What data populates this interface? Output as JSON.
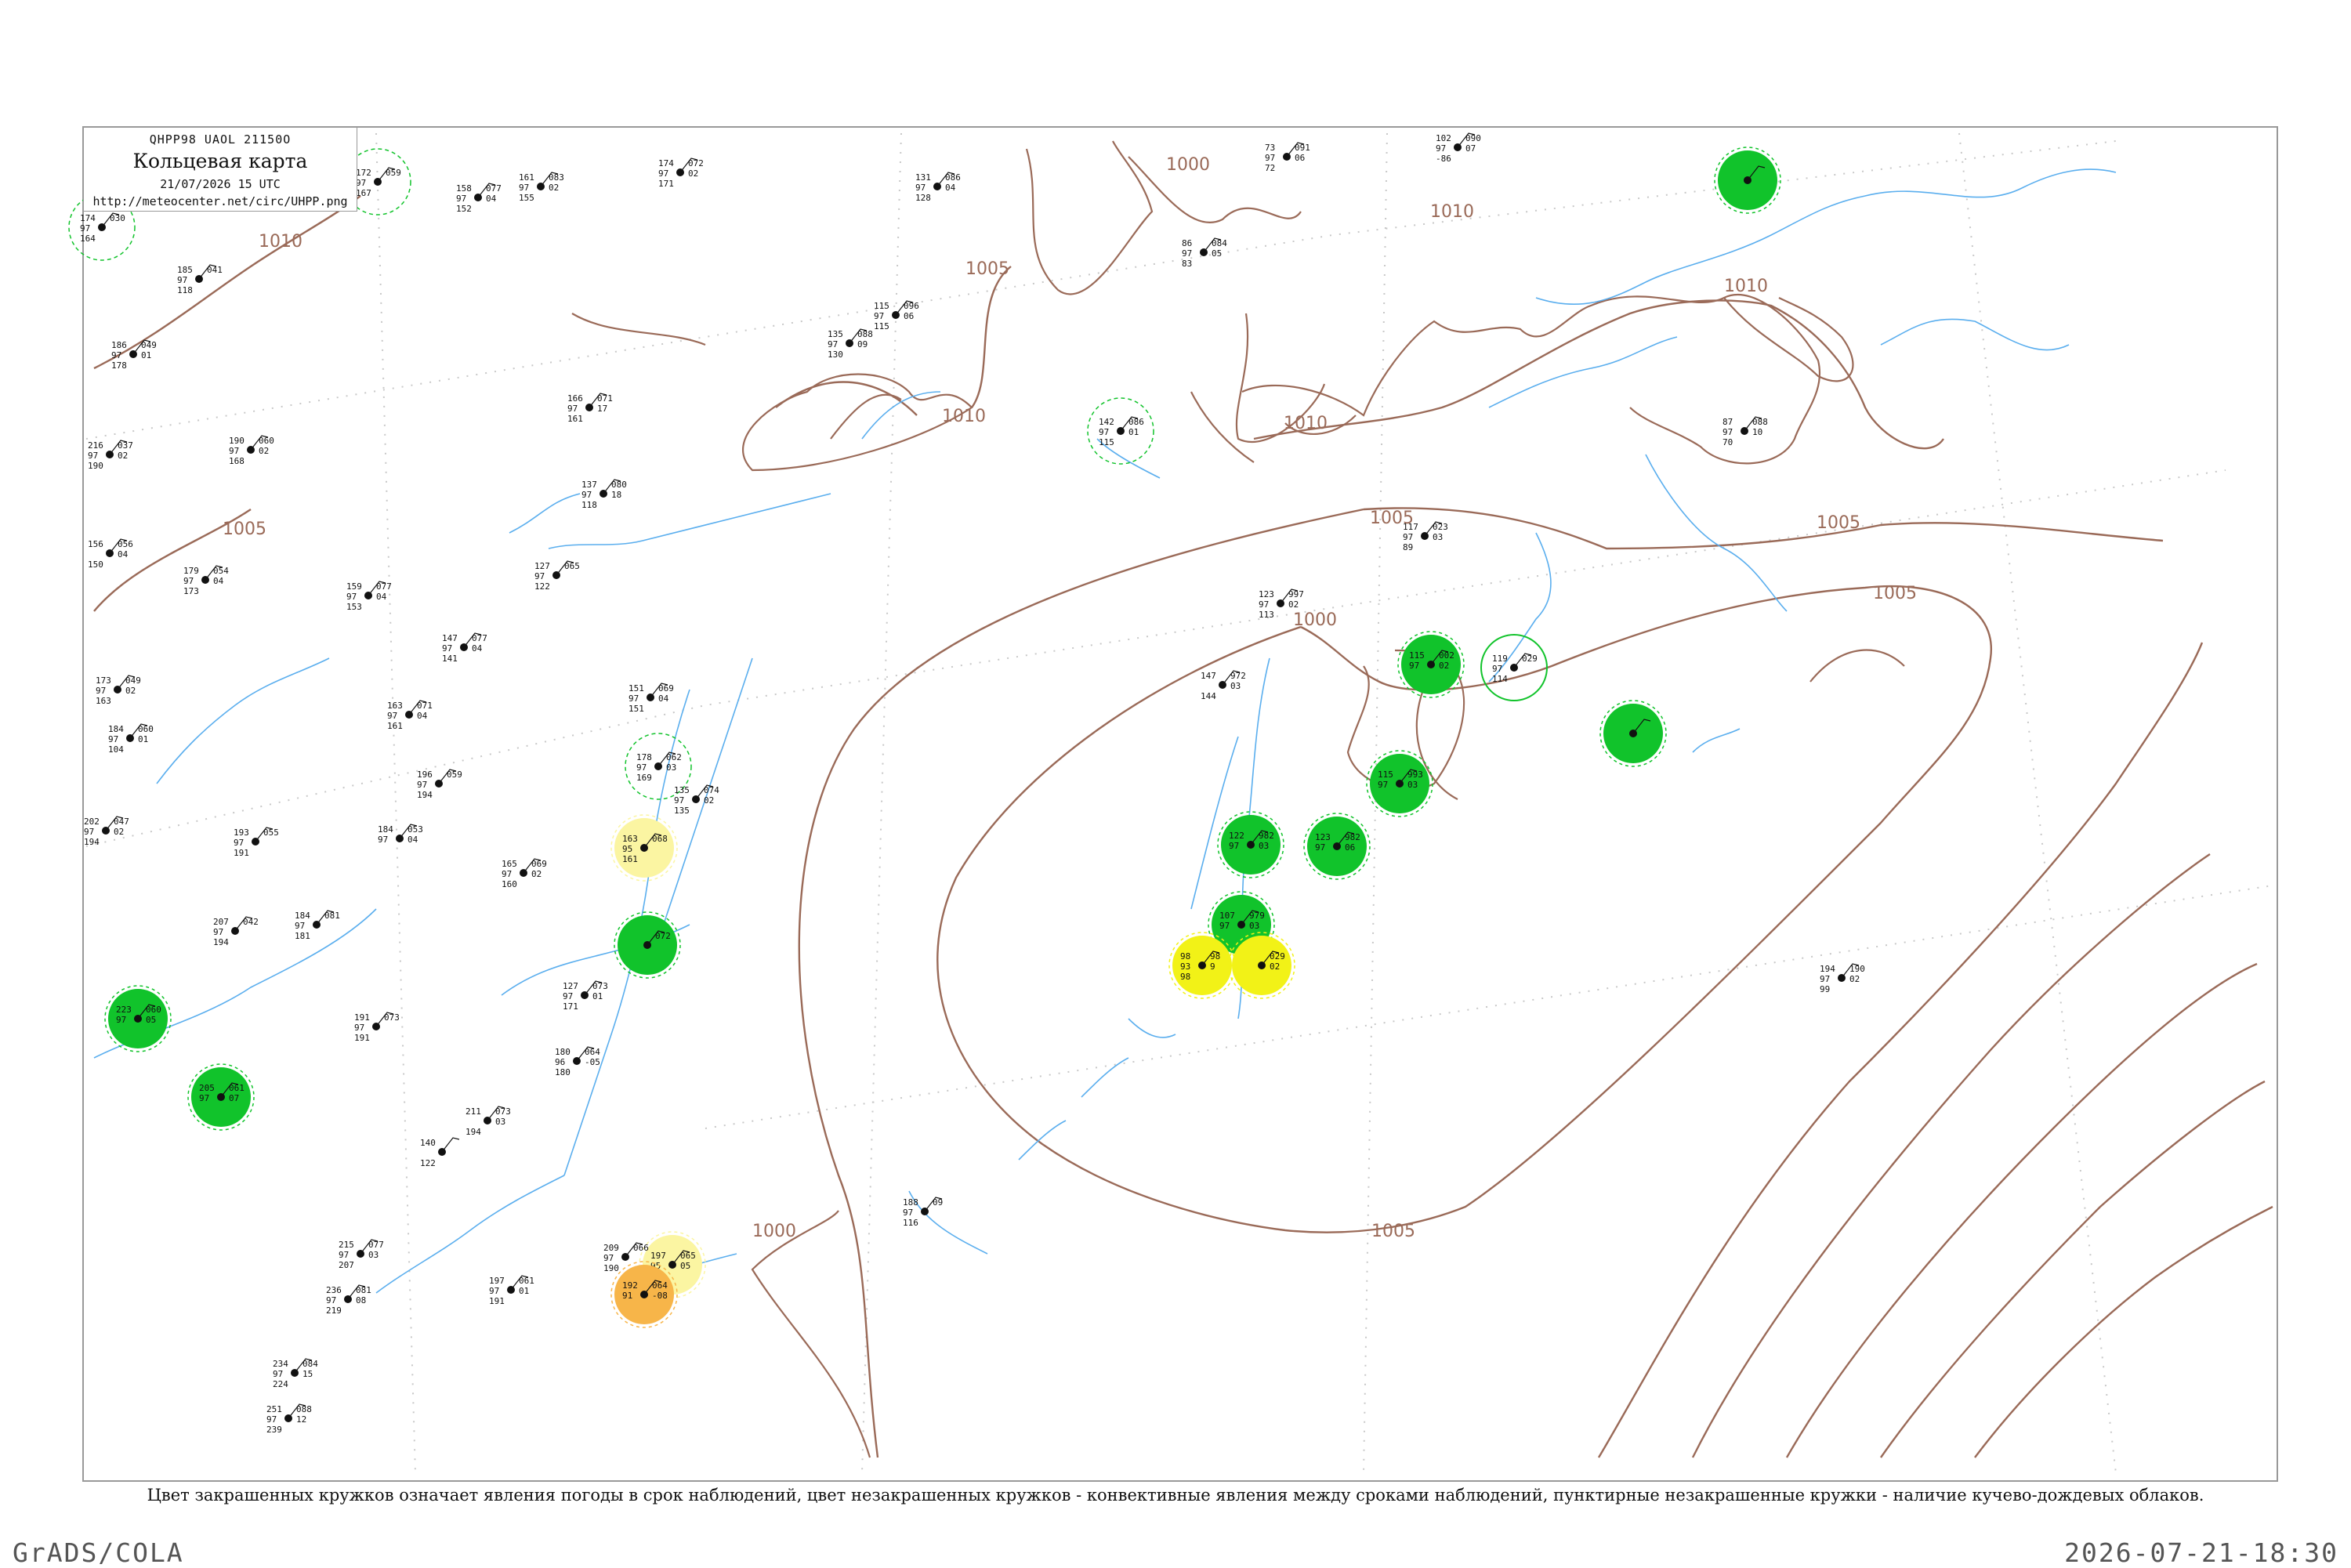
{
  "header": {
    "code": "QHPP98  UAOL  21150O",
    "title": "Кольцевая карта",
    "date": "21/07/2026 15 UTC",
    "url": "http://meteocenter.net/circ/UHPP.png"
  },
  "caption": "Цвет закрашенных кружков означает явления погоды в срок наблюдений, цвет незакрашенных кружков - конвективные явления между сроками наблюдений, пунктирные незакрашенные кружки - наличие кучево-дождевых облаков.",
  "footer": {
    "left": "GrADS/COLA",
    "right": "2026-07-21-18:30"
  },
  "colors": {
    "isobar": "#9a6a58",
    "water": "#5aaeee",
    "rain": "#11c32b",
    "fog": "#f2f217",
    "drizzle": "#fbf5a2",
    "haze": "#f7b549",
    "frame": "#999999"
  },
  "isobars": [
    {
      "label": "1000"
    },
    {
      "label": "1005"
    },
    {
      "label": "1010"
    },
    {
      "label": "1010"
    },
    {
      "label": "1010"
    },
    {
      "label": "1010"
    },
    {
      "label": "1010"
    },
    {
      "label": "1005"
    },
    {
      "label": "1005"
    },
    {
      "label": "1005"
    },
    {
      "label": "1005"
    },
    {
      "label": "1000"
    },
    {
      "label": "1000"
    },
    {
      "label": "1005"
    }
  ],
  "stations": [
    {
      "t": "174",
      "d": "97",
      "p": "030",
      "n": "",
      "code": "164",
      "marker": "dashed"
    },
    {
      "t": "172",
      "d": "97",
      "p": "059",
      "n": "",
      "code": "167",
      "marker": "dashed"
    },
    {
      "t": "185",
      "d": "97",
      "p": "041",
      "n": "",
      "code": "118",
      "marker": "none"
    },
    {
      "t": "186",
      "d": "97",
      "p": "049",
      "n": "01",
      "code": "178",
      "marker": "none"
    },
    {
      "t": "216",
      "d": "97",
      "p": "037",
      "n": "02",
      "code": "190",
      "marker": "none"
    },
    {
      "t": "190",
      "d": "97",
      "p": "060",
      "n": "02",
      "code": "168",
      "marker": "none"
    },
    {
      "t": "156",
      "d": "",
      "p": "056",
      "n": "04",
      "code": "150",
      "marker": "none"
    },
    {
      "t": "179",
      "d": "97",
      "p": "054",
      "n": "04",
      "code": "173",
      "marker": "none"
    },
    {
      "t": "173",
      "d": "97",
      "p": "049",
      "n": "02",
      "code": "163",
      "marker": "none"
    },
    {
      "t": "184",
      "d": "97",
      "p": "060",
      "n": "01",
      "code": "104",
      "marker": "none"
    },
    {
      "t": "202",
      "d": "97",
      "p": "047",
      "n": "02",
      "code": "194",
      "marker": "none"
    },
    {
      "t": "223",
      "d": "97",
      "p": "060",
      "n": "05",
      "code": "",
      "marker": "rain"
    },
    {
      "t": "205",
      "d": "97",
      "p": "061",
      "n": "07",
      "code": "",
      "marker": "rain"
    },
    {
      "t": "158",
      "d": "97",
      "p": "077",
      "n": "04",
      "code": "152",
      "marker": "none"
    },
    {
      "t": "161",
      "d": "97",
      "p": "083",
      "n": "02",
      "code": "155",
      "marker": "none"
    },
    {
      "t": "174",
      "d": "97",
      "p": "072",
      "n": "02",
      "code": "171",
      "marker": "none"
    },
    {
      "t": "131",
      "d": "97",
      "p": "086",
      "n": "04",
      "code": "128",
      "marker": "none"
    },
    {
      "t": "115",
      "d": "97",
      "p": "096",
      "n": "06",
      "code": "115",
      "marker": "none"
    },
    {
      "t": "135",
      "d": "97",
      "p": "088",
      "n": "09",
      "code": "130",
      "marker": "none"
    },
    {
      "t": "166",
      "d": "97",
      "p": "071",
      "n": "17",
      "code": "161",
      "marker": "none"
    },
    {
      "t": "137",
      "d": "97",
      "p": "080",
      "n": "18",
      "code": "118",
      "marker": "none"
    },
    {
      "t": "127",
      "d": "97",
      "p": "065",
      "n": "",
      "code": "122",
      "marker": "none"
    },
    {
      "t": "142",
      "d": "97",
      "p": "086",
      "n": "01",
      "code": "115",
      "marker": "dashed"
    },
    {
      "t": "73",
      "d": "97",
      "p": "091",
      "n": "06",
      "code": "72",
      "marker": "none"
    },
    {
      "t": "102",
      "d": "97",
      "p": "090",
      "n": "07",
      "code": "-86",
      "marker": "none"
    },
    {
      "t": "86",
      "d": "97",
      "p": "084",
      "n": "05",
      "code": "83",
      "marker": "none"
    },
    {
      "t": "87",
      "d": "97",
      "p": "088",
      "n": "10",
      "code": "70",
      "marker": "none"
    },
    {
      "t": "",
      "d": "",
      "p": "",
      "n": "",
      "code": "",
      "marker": "rain"
    },
    {
      "t": "117",
      "d": "97",
      "p": "023",
      "n": "03",
      "code": "89",
      "marker": "none"
    },
    {
      "t": "123",
      "d": "97",
      "p": "997",
      "n": "02",
      "code": "113",
      "marker": "none"
    },
    {
      "t": "119",
      "d": "97",
      "p": "029",
      "n": "",
      "code": "114",
      "marker": "open"
    },
    {
      "t": "115",
      "d": "97",
      "p": "002",
      "n": "02",
      "code": "",
      "marker": "rain"
    },
    {
      "t": "",
      "d": "",
      "p": "",
      "n": "",
      "code": "",
      "marker": "rain"
    },
    {
      "t": "115",
      "d": "97",
      "p": "993",
      "n": "03",
      "code": "",
      "marker": "rain"
    },
    {
      "t": "147",
      "d": "",
      "p": "972",
      "n": "03",
      "code": "144",
      "marker": "none"
    },
    {
      "t": "122",
      "d": "97",
      "p": "982",
      "n": "03",
      "code": "",
      "marker": "rain"
    },
    {
      "t": "123",
      "d": "97",
      "p": "982",
      "n": "06",
      "code": "",
      "marker": "rain"
    },
    {
      "t": "107",
      "d": "97",
      "p": "979",
      "n": "03",
      "code": "",
      "marker": "rain"
    },
    {
      "t": "98",
      "d": "93",
      "p": "98",
      "n": "9",
      "code": "98",
      "marker": "fog"
    },
    {
      "t": "",
      "d": "",
      "p": "029",
      "n": "02",
      "code": "",
      "marker": "fog"
    },
    {
      "t": "194",
      "d": "97",
      "p": "190",
      "n": "02",
      "code": "99",
      "marker": "none"
    },
    {
      "t": "163",
      "d": "95",
      "p": "068",
      "n": "",
      "code": "161",
      "marker": "drizzle"
    },
    {
      "t": "178",
      "d": "97",
      "p": "062",
      "n": "03",
      "code": "169",
      "marker": "dashed"
    },
    {
      "t": "135",
      "d": "97",
      "p": "074",
      "n": "02",
      "code": "135",
      "marker": "none"
    },
    {
      "t": "",
      "d": "",
      "p": "072",
      "n": "",
      "code": "",
      "marker": "rain"
    },
    {
      "t": "151",
      "d": "97",
      "p": "069",
      "n": "04",
      "code": "151",
      "marker": "none"
    },
    {
      "t": "127",
      "d": "97",
      "p": "073",
      "n": "01",
      "code": "171",
      "marker": "none"
    },
    {
      "t": "180",
      "d": "96",
      "p": "064",
      "n": "-05",
      "code": "180",
      "marker": "none"
    },
    {
      "t": "188",
      "d": "97",
      "p": "09",
      "n": "",
      "code": "116",
      "marker": "none"
    },
    {
      "t": "197",
      "d": "95",
      "p": "065",
      "n": "05",
      "code": "",
      "marker": "drizzle"
    },
    {
      "t": "192",
      "d": "91",
      "p": "064",
      "n": "-08",
      "code": "",
      "marker": "haze"
    },
    {
      "t": "140",
      "d": "",
      "p": "",
      "n": "",
      "code": "122",
      "marker": "none"
    },
    {
      "t": "211",
      "d": "",
      "p": "073",
      "n": "03",
      "code": "194",
      "marker": "none"
    },
    {
      "t": "209",
      "d": "97",
      "p": "066",
      "n": "",
      "code": "190",
      "marker": "none"
    },
    {
      "t": "197",
      "d": "97",
      "p": "061",
      "n": "01",
      "code": "191",
      "marker": "none"
    },
    {
      "t": "215",
      "d": "97",
      "p": "077",
      "n": "03",
      "code": "207",
      "marker": "none"
    },
    {
      "t": "236",
      "d": "97",
      "p": "081",
      "n": "08",
      "code": "219",
      "marker": "none"
    },
    {
      "t": "234",
      "d": "97",
      "p": "084",
      "n": "15",
      "code": "224",
      "marker": "none"
    },
    {
      "t": "251",
      "d": "97",
      "p": "088",
      "n": "12",
      "code": "239",
      "marker": "none"
    },
    {
      "t": "184",
      "d": "97",
      "p": "081",
      "n": "",
      "code": "181",
      "marker": "none"
    },
    {
      "t": "191",
      "d": "97",
      "p": "073",
      "n": "",
      "code": "191",
      "marker": "none"
    },
    {
      "t": "196",
      "d": "97",
      "p": "059",
      "n": "",
      "code": "194",
      "marker": "none"
    },
    {
      "t": "165",
      "d": "97",
      "p": "069",
      "n": "02",
      "code": "160",
      "marker": "none"
    },
    {
      "t": "159",
      "d": "97",
      "p": "077",
      "n": "04",
      "code": "153",
      "marker": "none"
    },
    {
      "t": "147",
      "d": "97",
      "p": "077",
      "n": "04",
      "code": "141",
      "marker": "none"
    },
    {
      "t": "163",
      "d": "97",
      "p": "071",
      "n": "04",
      "code": "161",
      "marker": "none"
    },
    {
      "t": "184",
      "d": "97",
      "p": "053",
      "n": "04",
      "code": "",
      "marker": "none"
    },
    {
      "t": "193",
      "d": "97",
      "p": "055",
      "n": "",
      "code": "191",
      "marker": "none"
    },
    {
      "t": "207",
      "d": "97",
      "p": "042",
      "n": "",
      "code": "194",
      "marker": "none"
    }
  ]
}
